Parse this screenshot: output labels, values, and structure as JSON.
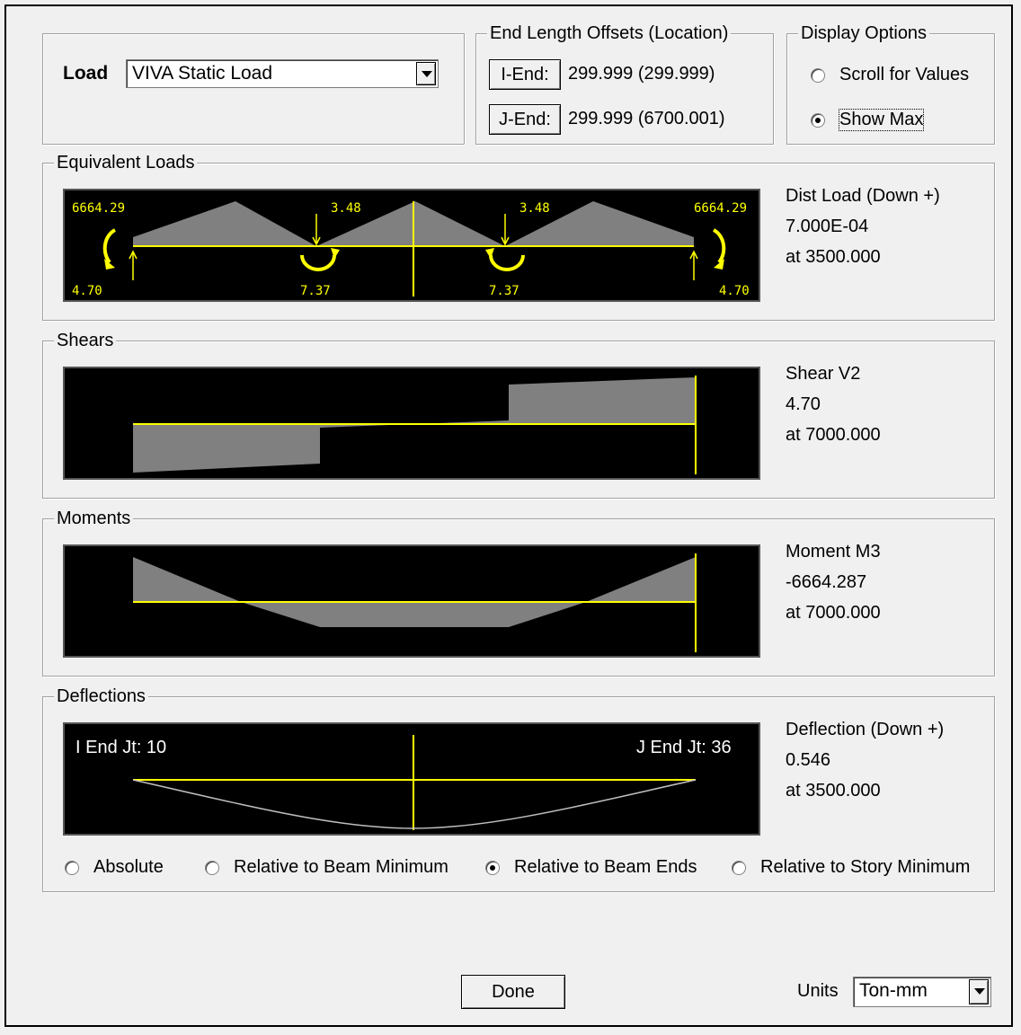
{
  "load": {
    "label": "Load",
    "selected": "VIVA Static Load"
  },
  "offsets": {
    "legend": "End Length Offsets (Location)",
    "i_end": {
      "button": "I-End:",
      "value": "299.999  (299.999)"
    },
    "j_end": {
      "button": "J-End:",
      "value": "299.999  (6700.001)"
    }
  },
  "display": {
    "legend": "Display Options",
    "scroll": "Scroll for Values",
    "show_max": "Show Max",
    "selected": "show_max"
  },
  "equivalent": {
    "legend": "Equivalent Loads",
    "caption": "Dist Load (Down +)",
    "value": "7.000E-04",
    "at": "at 3500.000",
    "labels": {
      "left_moment": "6664.29",
      "right_moment": "6664.29",
      "point1": "3.48",
      "point2": "3.48",
      "left_reaction": "4.70",
      "right_reaction": "4.70",
      "mid_moment1": "7.37",
      "mid_moment2": "7.37"
    }
  },
  "shears": {
    "legend": "Shears",
    "caption": "Shear V2",
    "value": "4.70",
    "at": "at 7000.000"
  },
  "moments": {
    "legend": "Moments",
    "caption": "Moment M3",
    "value": "-6664.287",
    "at": "at 7000.000"
  },
  "deflections": {
    "legend": "Deflections",
    "caption": "Deflection (Down +)",
    "value": "0.546",
    "at": "at 3500.000",
    "i_end_jt": "I End Jt: 10",
    "j_end_jt": "J End Jt: 36",
    "options": [
      "Absolute",
      "Relative to Beam Minimum",
      "Relative to Beam Ends",
      "Relative to Story Minimum"
    ],
    "selected_index": 2
  },
  "done": "Done",
  "units": {
    "label": "Units",
    "selected": "Ton-mm"
  },
  "colors": {
    "axis": "#ffff00",
    "fill": "#808080",
    "plot_bg": "#000000",
    "deflection_line": "#c0c0c0"
  }
}
